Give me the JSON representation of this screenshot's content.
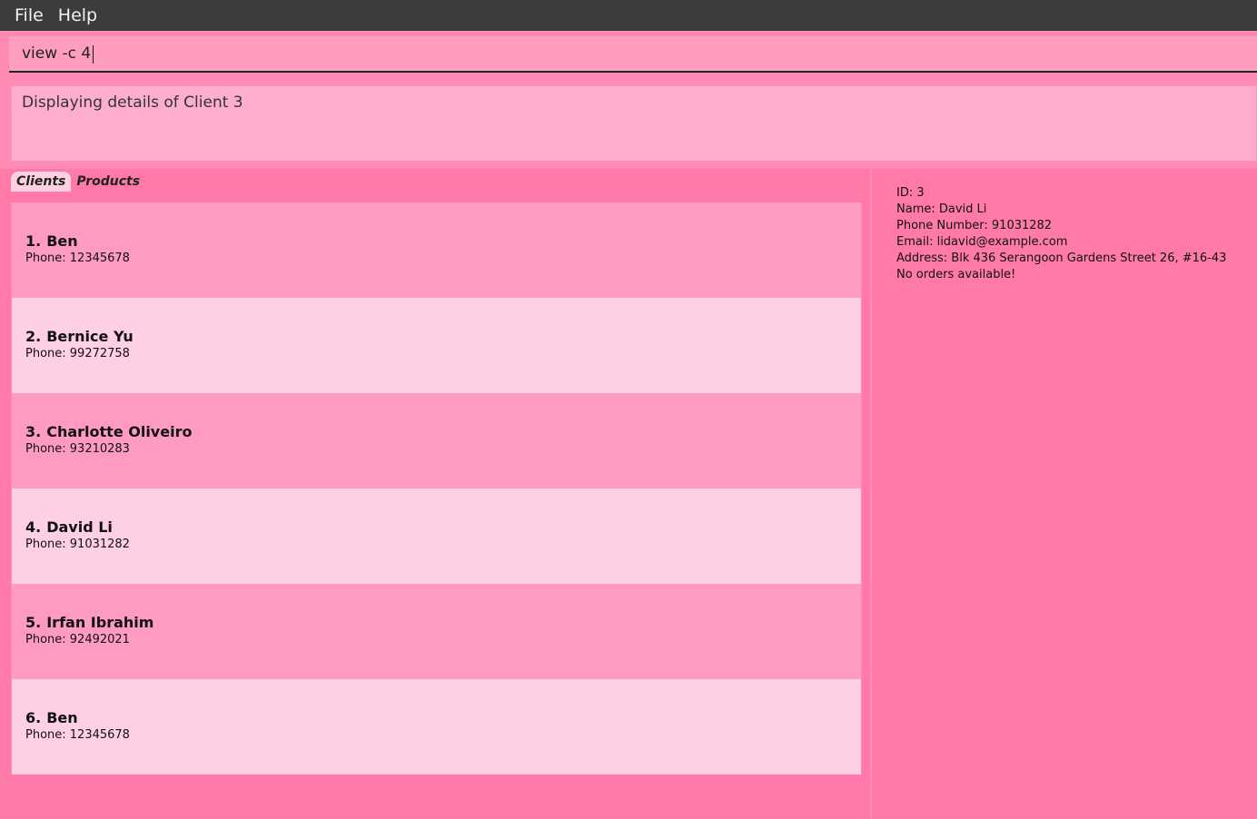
{
  "menu": {
    "file": "File",
    "help": "Help"
  },
  "command": {
    "value": "view -c 4"
  },
  "result": {
    "message": "Displaying details of Client 3"
  },
  "tabs": [
    {
      "label": "Clients",
      "active": true
    },
    {
      "label": "Products",
      "active": false
    }
  ],
  "clients": [
    {
      "index": "1.",
      "name": "Ben",
      "phone": "Phone: 12345678"
    },
    {
      "index": "2.",
      "name": "Bernice Yu",
      "phone": "Phone: 99272758"
    },
    {
      "index": "3.",
      "name": "Charlotte Oliveiro",
      "phone": "Phone: 93210283"
    },
    {
      "index": "4.",
      "name": "David Li",
      "phone": "Phone: 91031282"
    },
    {
      "index": "5.",
      "name": "Irfan Ibrahim",
      "phone": "Phone: 92492021"
    },
    {
      "index": "6.",
      "name": "Ben",
      "phone": "Phone: 12345678"
    }
  ],
  "details": {
    "id": "ID: 3",
    "name": "Name: David Li",
    "phone": "Phone Number: 91031282",
    "email": "Email: lidavid@example.com",
    "address": "Address: Blk 436 Serangoon Gardens Street 26, #16-43",
    "orders": "No orders available!"
  },
  "colors": {
    "menubar": "#3c3c3c",
    "background": "#ff7aa8",
    "list_odd": "#ff9bc2",
    "list_even": "#ffcfe3"
  }
}
